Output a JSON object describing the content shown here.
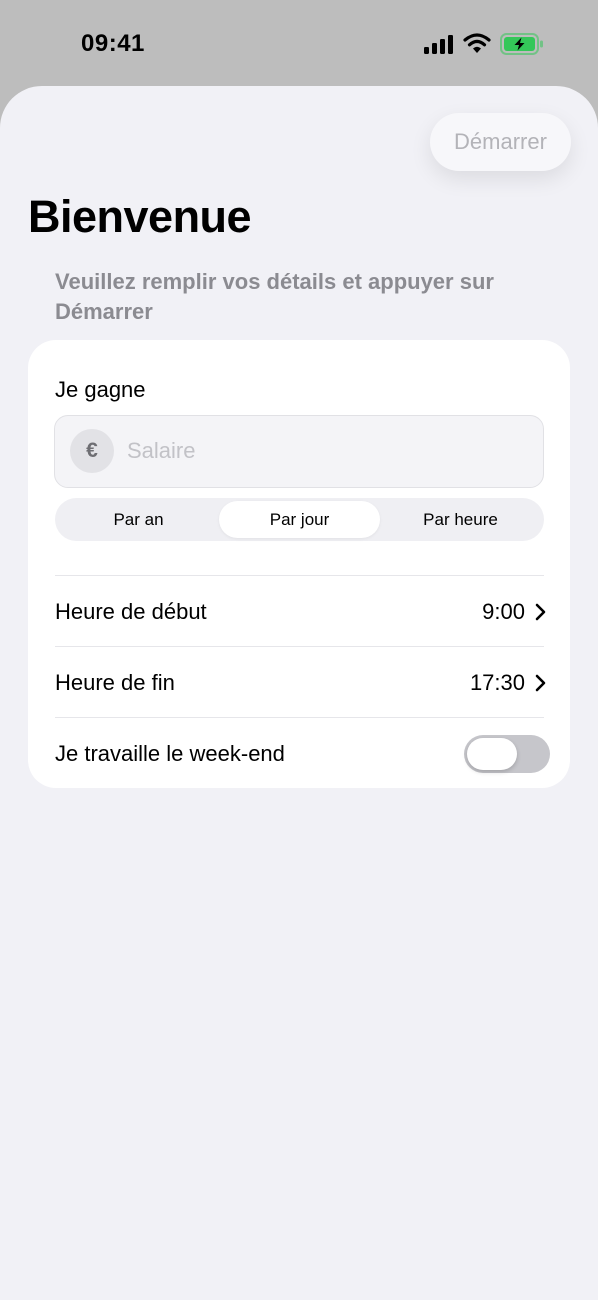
{
  "status_bar": {
    "time": "09:41",
    "icons": [
      "signal-icon",
      "wifi-icon",
      "battery-charging-icon"
    ],
    "battery_color": "#34c759"
  },
  "header": {
    "start_label": "Démarrer",
    "title": "Bienvenue",
    "subtitle": "Veuillez remplir vos détails et appuyer sur Démarrer"
  },
  "form": {
    "earn_label": "Je gagne",
    "salary": {
      "currency_symbol": "€",
      "placeholder": "Salaire",
      "value": ""
    },
    "period_options": [
      {
        "label": "Par an",
        "selected": false
      },
      {
        "label": "Par jour",
        "selected": true
      },
      {
        "label": "Par heure",
        "selected": false
      }
    ],
    "start_time": {
      "label": "Heure de début",
      "value": "9:00"
    },
    "end_time": {
      "label": "Heure de fin",
      "value": "17:30"
    },
    "weekend": {
      "label": "Je travaille le week-end",
      "on": false
    }
  },
  "colors": {
    "background": "#f1f1f6",
    "card": "#ffffff",
    "muted_text": "#8b8b91",
    "toggle_off": "#c6c6cb"
  }
}
